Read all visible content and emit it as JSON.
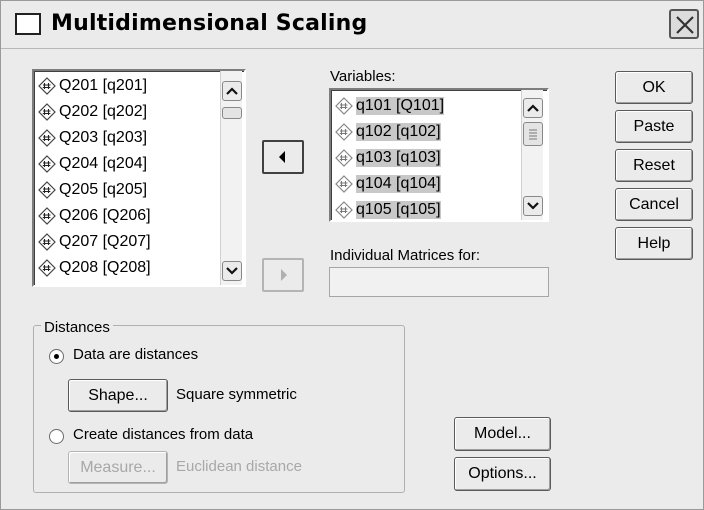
{
  "window": {
    "title": "Multidimensional Scaling"
  },
  "source_list": {
    "items": [
      {
        "label": "Q201 [q201]"
      },
      {
        "label": "Q202 [q202]"
      },
      {
        "label": "Q203 [q203]"
      },
      {
        "label": "Q204 [q204]"
      },
      {
        "label": "Q205 [q205]"
      },
      {
        "label": "Q206 [Q206]"
      },
      {
        "label": "Q207 [Q207]"
      },
      {
        "label": "Q208 [Q208]"
      }
    ]
  },
  "variables": {
    "label": "Variables:",
    "items": [
      {
        "label": "q101 [Q101]"
      },
      {
        "label": "q102 [q102]"
      },
      {
        "label": "q103 [q103]"
      },
      {
        "label": "q104 [q104]"
      },
      {
        "label": "q105 [q105]"
      }
    ]
  },
  "individual_matrices": {
    "label": "Individual Matrices for:",
    "value": ""
  },
  "buttons": {
    "ok": "OK",
    "paste": "Paste",
    "reset": "Reset",
    "cancel": "Cancel",
    "help": "Help",
    "model": "Model...",
    "options": "Options..."
  },
  "distances": {
    "group_title": "Distances",
    "data_are_distances": "Data are distances",
    "selected_option": "Data are distances",
    "shape_button": "Shape...",
    "shape_value": "Square symmetric",
    "create_from_data": "Create distances from data",
    "measure_button": "Measure...",
    "measure_value": "Euclidean distance"
  },
  "icons": {
    "variable": "scale-variable-icon",
    "close": "close-icon",
    "move_left": "arrow-left-icon",
    "move_right": "arrow-right-icon"
  }
}
